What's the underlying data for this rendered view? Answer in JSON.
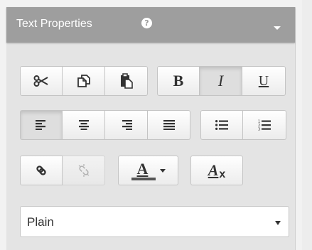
{
  "panel": {
    "title": "Text Properties",
    "help_glyph": "?",
    "help_icon": "question-circle-icon",
    "collapse_icon": "caret-down-icon"
  },
  "toolbar": {
    "clipboard": [
      {
        "name": "cut",
        "icon": "scissors-icon",
        "glyph": "✄"
      },
      {
        "name": "copy",
        "icon": "copy-icon",
        "glyph": "⎘"
      },
      {
        "name": "paste",
        "icon": "paste-icon",
        "glyph": "📋"
      }
    ],
    "style": [
      {
        "name": "bold",
        "label": "B",
        "active": false
      },
      {
        "name": "italic",
        "label": "I",
        "active": true
      },
      {
        "name": "underline",
        "label": "U",
        "active": false
      }
    ],
    "align": [
      {
        "name": "align-left",
        "icon": "align-left-icon",
        "active": true
      },
      {
        "name": "align-center",
        "icon": "align-center-icon",
        "active": false
      },
      {
        "name": "align-right",
        "icon": "align-right-icon",
        "active": false
      },
      {
        "name": "align-justify",
        "icon": "align-justify-icon",
        "active": false
      }
    ],
    "lists": [
      {
        "name": "bulleted-list",
        "icon": "list-ul-icon"
      },
      {
        "name": "numbered-list",
        "icon": "list-ol-icon"
      }
    ],
    "links": [
      {
        "name": "insert-link",
        "icon": "link-icon",
        "enabled": true
      },
      {
        "name": "remove-link",
        "icon": "unlink-icon",
        "enabled": false
      }
    ],
    "text_color": {
      "label": "A",
      "icon": "text-color-icon",
      "caret_icon": "caret-down-icon",
      "swatch_color": "#555555"
    },
    "clear_format": {
      "label": "A",
      "subscript": "x",
      "icon": "clear-format-icon"
    }
  },
  "format_select": {
    "value": "Plain",
    "caret_icon": "caret-down-icon"
  },
  "colors": {
    "header_bg": "#9e9e9e",
    "panel_bg": "#e4e4e4",
    "button_border": "#c4c4c4"
  }
}
